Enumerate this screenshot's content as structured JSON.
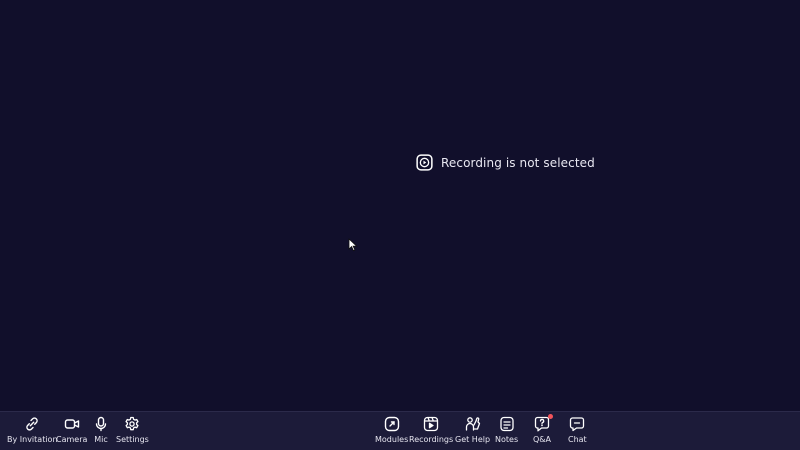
{
  "main": {
    "empty_state": {
      "icon": "play-square-icon",
      "message": "Recording is not selected"
    }
  },
  "toolbar": {
    "left": [
      {
        "id": "by-invitation",
        "label": "By Invitation",
        "icon": "link-icon"
      },
      {
        "id": "camera",
        "label": "Camera",
        "icon": "camera-icon"
      },
      {
        "id": "mic",
        "label": "Mic",
        "icon": "mic-icon"
      },
      {
        "id": "settings",
        "label": "Settings",
        "icon": "gear-icon"
      }
    ],
    "right": [
      {
        "id": "modules",
        "label": "Modules",
        "icon": "modules-icon"
      },
      {
        "id": "recordings",
        "label": "Recordings",
        "icon": "recordings-icon"
      },
      {
        "id": "get-help",
        "label": "Get Help",
        "icon": "help-hand-icon"
      },
      {
        "id": "notes",
        "label": "Notes",
        "icon": "notes-icon"
      },
      {
        "id": "qa",
        "label": "Q&A",
        "icon": "qa-icon",
        "notification_dot": true
      },
      {
        "id": "chat",
        "label": "Chat",
        "icon": "chat-icon"
      }
    ]
  },
  "colors": {
    "background": "#110f2b",
    "toolbar": "#1c1b39",
    "text": "#e6e5ef",
    "badge": "#f2545b"
  }
}
